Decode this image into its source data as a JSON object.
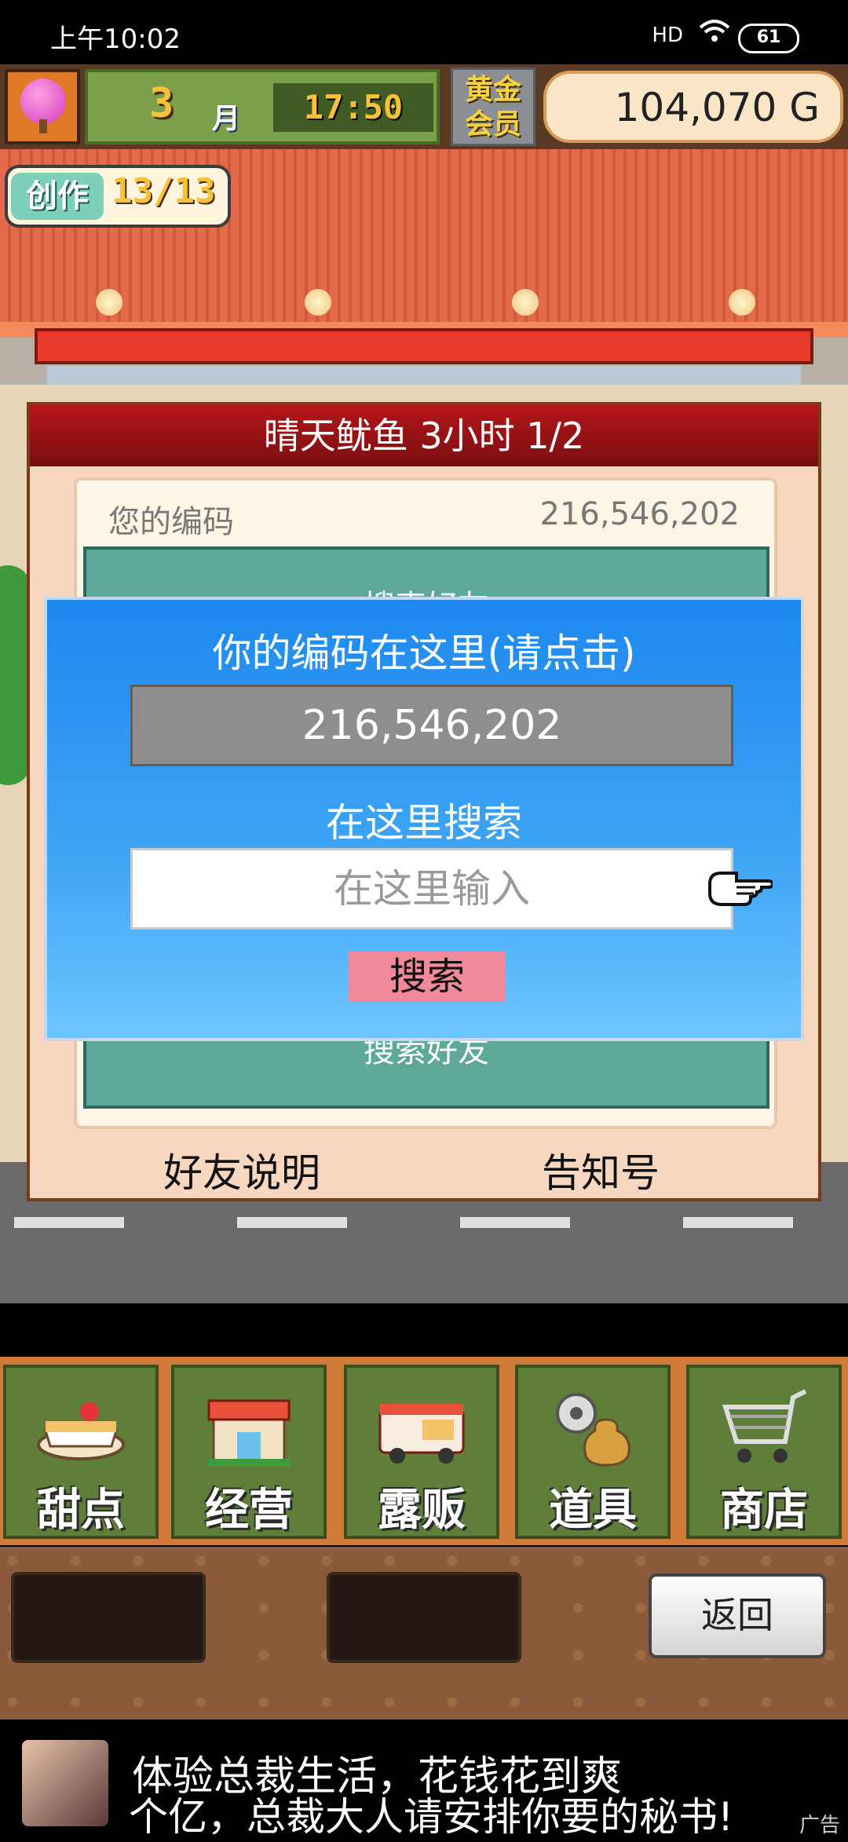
{
  "status_bar": {
    "time": "上午10:02",
    "signal": "HD",
    "battery": "61"
  },
  "hud": {
    "month_number": "3",
    "month_label": "月",
    "clock": "17:50",
    "gold_member_line1": "黄金",
    "gold_member_line2": "会员",
    "money": "104,070 G"
  },
  "create_badge": {
    "label": "创作",
    "count": "13/13"
  },
  "panel": {
    "title": "晴天鱿鱼  3小时 1/2",
    "my_code_label": "您的编码",
    "my_code_value": "216,546,202",
    "search_friend_top": "搜索好友",
    "search_friend_bottom": "搜索好友",
    "friend_explain": "好友说明",
    "notice_no": "告知号"
  },
  "dialog": {
    "code_title": "你的编码在这里(请点击)",
    "code_value": "216,546,202",
    "search_title": "在这里搜索",
    "search_placeholder": "在这里输入",
    "search_button": "搜索"
  },
  "menu": [
    {
      "label": "甜点",
      "icon": "cake-icon"
    },
    {
      "label": "经营",
      "icon": "store-icon"
    },
    {
      "label": "露贩",
      "icon": "food-truck-icon"
    },
    {
      "label": "道具",
      "icon": "gear-bag-icon"
    },
    {
      "label": "商店",
      "icon": "shopping-cart-icon"
    }
  ],
  "back_button": "返回",
  "ad": {
    "line1": "体验总裁生活，花钱花到爽",
    "line2": "个亿，总裁大人请安排你要的秘书!",
    "tag": "广告"
  },
  "colors": {
    "dialog_blue": "#1e88f0",
    "title_red": "#b4161a",
    "search_button_pink": "#f08a9a",
    "menu_green": "#5e7e3a"
  }
}
